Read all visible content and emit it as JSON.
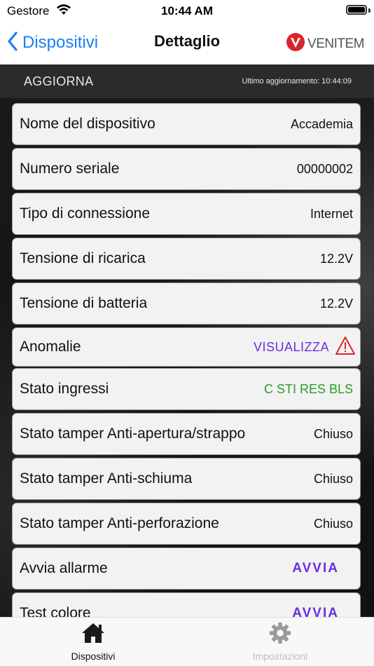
{
  "status_bar": {
    "carrier": "Gestore",
    "time": "10:44 AM"
  },
  "nav": {
    "back_label": "Dispositivi",
    "title": "Dettaglio",
    "logo_text": "VENITEM"
  },
  "update_bar": {
    "button_label": "AGGIORNA",
    "last_update": "Ultimo aggiornamento: 10:44:09"
  },
  "rows": [
    {
      "label": "Nome del dispositivo",
      "value": "Accademia"
    },
    {
      "label": "Numero seriale",
      "value": "00000002"
    },
    {
      "label": "Tipo di connessione",
      "value": "Internet"
    },
    {
      "label": "Tensione di ricarica",
      "value": "12.2V"
    },
    {
      "label": "Tensione di batteria",
      "value": "12.2V"
    },
    {
      "label": "Anomalie",
      "value": "VISUALIZZA"
    },
    {
      "label": "Stato ingressi",
      "value": "C STI RES BLS"
    },
    {
      "label": "Stato tamper Anti-apertura/strappo",
      "value": "Chiuso"
    },
    {
      "label": "Stato tamper Anti-schiuma",
      "value": "Chiuso"
    },
    {
      "label": "Stato tamper Anti-perforazione",
      "value": "Chiuso"
    },
    {
      "label": "Avvia allarme",
      "value": "AVVIA"
    },
    {
      "label": "Test colore",
      "value": "AVVIA"
    }
  ],
  "tabs": [
    {
      "label": "Dispositivi",
      "icon": "house-icon",
      "active": true
    },
    {
      "label": "Impostazioni",
      "icon": "gear-icon",
      "active": false
    }
  ],
  "colors": {
    "accent_blue": "#1a7ff5",
    "link_purple": "#6a2ee0",
    "status_green": "#2a9d2a",
    "warning_red": "#e0242a",
    "logo_red": "#d7262b"
  }
}
